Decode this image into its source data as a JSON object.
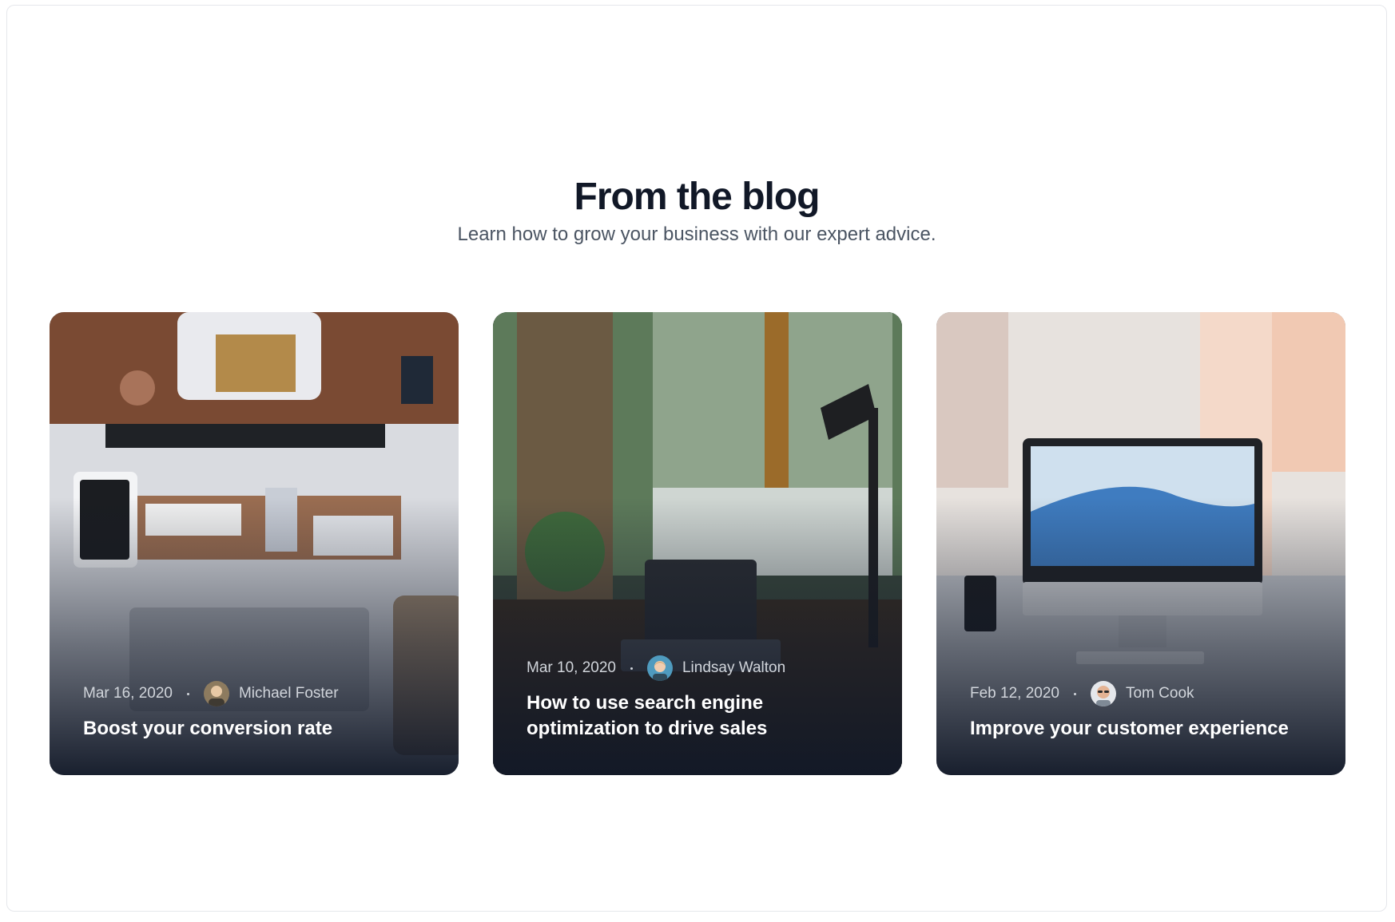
{
  "section": {
    "title": "From the blog",
    "subtitle": "Learn how to grow your business with our expert advice."
  },
  "posts": [
    {
      "date": "Mar 16, 2020",
      "author": "Michael Foster",
      "title": "Boost your conversion rate",
      "image": "desk-flatlay-photo",
      "avatar": "michael-foster-avatar"
    },
    {
      "date": "Mar 10, 2020",
      "author": "Lindsay Walton",
      "title": "How to use search engine optimization to drive sales",
      "image": "laptop-window-forest-photo",
      "avatar": "lindsay-walton-avatar"
    },
    {
      "date": "Feb 12, 2020",
      "author": "Tom Cook",
      "title": "Improve your customer experience",
      "image": "imac-desk-photo",
      "avatar": "tom-cook-avatar"
    }
  ],
  "colors": {
    "heading": "#111827",
    "subtitle": "#4b5563",
    "meta": "#d1d5db",
    "card_overlay": "#111827"
  }
}
